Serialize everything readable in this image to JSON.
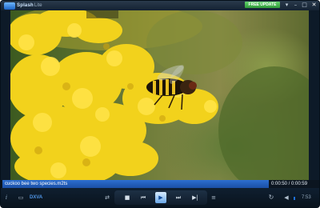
{
  "titlebar": {
    "app_name": "Splash",
    "app_edition": "Lite",
    "free_update_label": "FREE UPDATE",
    "buttons": {
      "settings": "▾",
      "minimize": "–",
      "maximize": "□",
      "close": "✕"
    }
  },
  "filebar": {
    "file_name": "cuckoo bee two species.m2ts",
    "time": "0:00:50 / 0:00:59"
  },
  "controls": {
    "info_icon": "i",
    "screen_icon": "▭",
    "dxva_label": "DXVA",
    "shuffle_icon": "⇄",
    "stop": "■",
    "previous": "⏮",
    "play": "▶",
    "next": "⏭",
    "next_frame": "▶|",
    "playlist_icon": "≡",
    "repeat_icon": "↻",
    "volume_icon": "◀",
    "time_remaining": "7:53"
  },
  "colors": {
    "accent": "#1f6fd8",
    "free_update": "#3fb14a",
    "window_bg": "#0d1a28"
  }
}
